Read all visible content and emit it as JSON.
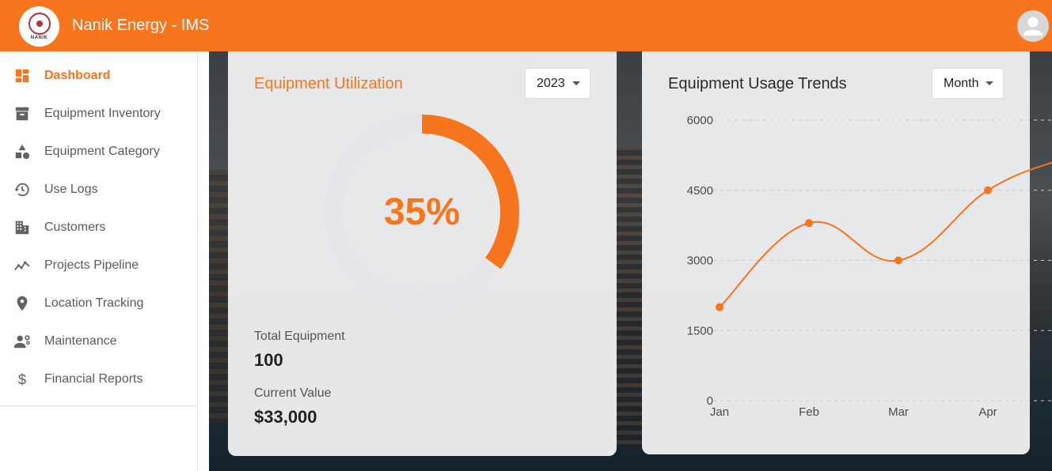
{
  "app": {
    "title": "Nanik Energy - IMS",
    "logo_text": "NANIK"
  },
  "sidebar": {
    "items": [
      {
        "label": "Dashboard",
        "icon": "dashboard-icon",
        "active": true
      },
      {
        "label": "Equipment Inventory",
        "icon": "archive-icon",
        "active": false
      },
      {
        "label": "Equipment Category",
        "icon": "category-icon",
        "active": false
      },
      {
        "label": "Use Logs",
        "icon": "history-icon",
        "active": false
      },
      {
        "label": "Customers",
        "icon": "building-icon",
        "active": false
      },
      {
        "label": "Projects Pipeline",
        "icon": "trending-icon",
        "active": false
      },
      {
        "label": "Location Tracking",
        "icon": "location-pin-icon",
        "active": false
      },
      {
        "label": "Maintenance",
        "icon": "engineer-icon",
        "active": false
      },
      {
        "label": "Financial Reports",
        "icon": "dollar-icon",
        "active": false
      }
    ]
  },
  "utilization": {
    "title": "Equipment Utilization",
    "year_select": "2023",
    "percent_label": "35%",
    "percent_value": 0.35,
    "total_label": "Total Equipment",
    "total_value": "100",
    "current_label": "Current Value",
    "current_value": "$33,000"
  },
  "trends": {
    "title": "Equipment Usage Trends",
    "period_select": "Month"
  },
  "chart_data": {
    "type": "line",
    "title": "Equipment Usage Trends",
    "categories": [
      "Jan",
      "Feb",
      "Mar",
      "Apr"
    ],
    "series": [
      {
        "values": [
          2000,
          3800,
          3000,
          4500
        ]
      }
    ],
    "yticks": [
      "6000",
      "4500",
      "3000",
      "1500",
      "0"
    ],
    "ylim": [
      0,
      6000
    ],
    "grid": "dashed horizontal",
    "color": "#f7751c"
  },
  "colors": {
    "accent": "#f7751c",
    "donut_track": "#e4e6ea"
  }
}
